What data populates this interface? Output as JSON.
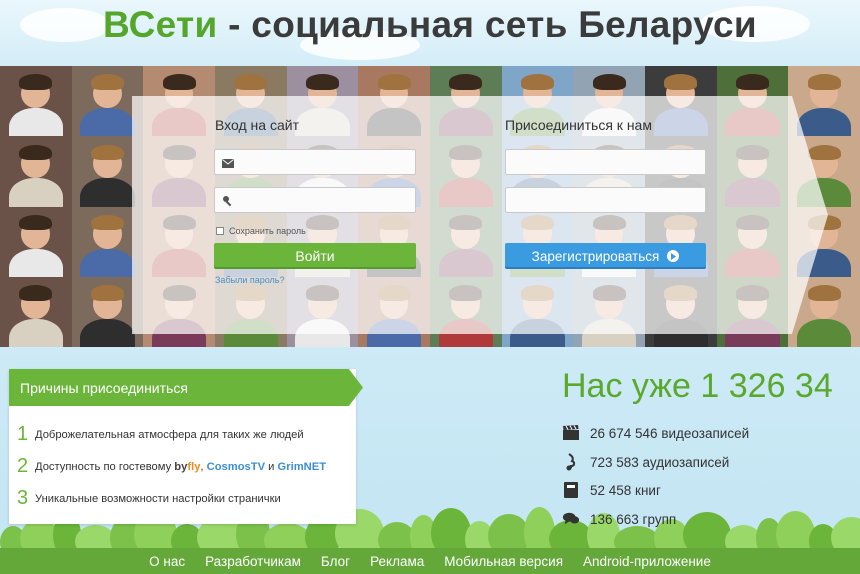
{
  "header": {
    "brand": "ВСети",
    "title_rest": " - социальная сеть Беларуси"
  },
  "login": {
    "title": "Вход на сайт",
    "email_icon": "envelope-icon",
    "password_icon": "key-icon",
    "remember_label": "Сохранить пароль",
    "submit_label": "Войти",
    "forgot_label": "Забыли пароль?"
  },
  "register": {
    "title": "Присоединиться к нам",
    "submit_label": "Зарегистрироваться",
    "submit_icon": "arrow-right-circle-icon"
  },
  "reasons": {
    "title": "Причины присоединиться",
    "items": [
      {
        "num": "1",
        "text": "Доброжелательная атмосфера для таких же людей"
      },
      {
        "num": "2",
        "text_prefix": "Доступность по гостевому ",
        "isp1_a": "by",
        "isp1_b": "fly",
        "sep1": ", ",
        "isp2": "CosmosTV",
        "sep2": " и ",
        "isp3": "GrimNET"
      },
      {
        "num": "3",
        "text": "Уникальные возможности настройки странички"
      }
    ]
  },
  "stats": {
    "counter": "Нас уже 1 326 34",
    "items": [
      {
        "icon": "clapperboard-icon",
        "text": "26 674 546 видеозаписей"
      },
      {
        "icon": "music-note-icon",
        "text": "723 583 аудиозаписей"
      },
      {
        "icon": "book-icon",
        "text": "52 458 книг"
      },
      {
        "icon": "chat-bubbles-icon",
        "text": "136 663 групп"
      }
    ]
  },
  "footer": {
    "links": [
      "О нас",
      "Разработчикам",
      "Блог",
      "Реклама",
      "Мобильная версия",
      "Android-приложение"
    ]
  },
  "colors": {
    "brand_green": "#55a62a",
    "button_green": "#6bb63a",
    "button_blue": "#3b9be0",
    "footer_green": "#64a83a",
    "sky": "#cfe9f4"
  }
}
